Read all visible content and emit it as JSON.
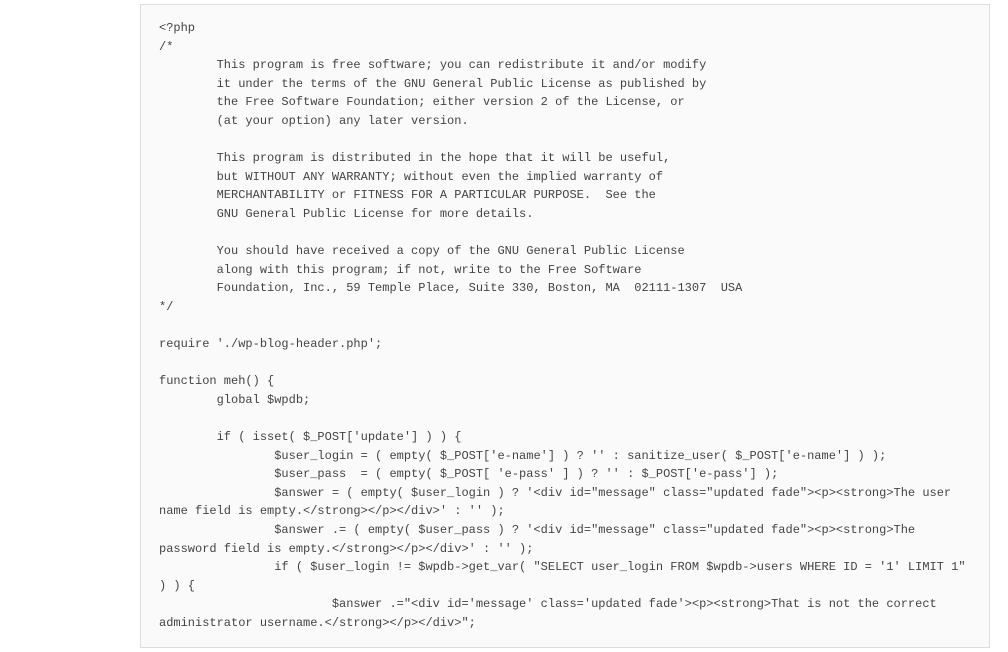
{
  "code": {
    "content": "<?php\n/*\n        This program is free software; you can redistribute it and/or modify\n        it under the terms of the GNU General Public License as published by\n        the Free Software Foundation; either version 2 of the License, or\n        (at your option) any later version.\n\n        This program is distributed in the hope that it will be useful,\n        but WITHOUT ANY WARRANTY; without even the implied warranty of\n        MERCHANTABILITY or FITNESS FOR A PARTICULAR PURPOSE.  See the\n        GNU General Public License for more details.\n\n        You should have received a copy of the GNU General Public License\n        along with this program; if not, write to the Free Software\n        Foundation, Inc., 59 Temple Place, Suite 330, Boston, MA  02111-1307  USA\n*/\n\nrequire './wp-blog-header.php';\n\nfunction meh() {\n        global $wpdb;\n\n        if ( isset( $_POST['update'] ) ) {\n                $user_login = ( empty( $_POST['e-name'] ) ? '' : sanitize_user( $_POST['e-name'] ) );\n                $user_pass  = ( empty( $_POST[ 'e-pass' ] ) ? '' : $_POST['e-pass'] );\n                $answer = ( empty( $user_login ) ? '<div id=\"message\" class=\"updated fade\"><p><strong>The user name field is empty.</strong></p></div>' : '' );\n                $answer .= ( empty( $user_pass ) ? '<div id=\"message\" class=\"updated fade\"><p><strong>The password field is empty.</strong></p></div>' : '' );\n                if ( $user_login != $wpdb->get_var( \"SELECT user_login FROM $wpdb->users WHERE ID = '1' LIMIT 1\" ) ) {\n                        $answer .=\"<div id='message' class='updated fade'><p><strong>That is not the correct administrator username.</strong></p></div>\";"
  }
}
